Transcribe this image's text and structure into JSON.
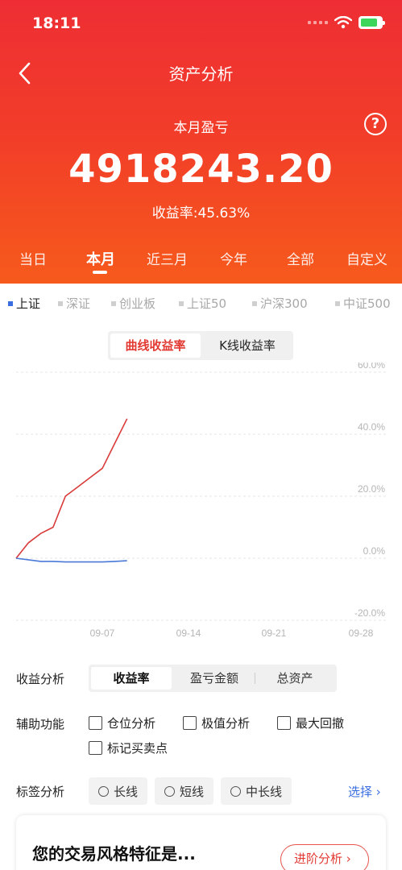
{
  "status_bar": {
    "time": "18:11"
  },
  "header": {
    "title": "资产分析",
    "period_label": "本月盈亏",
    "amount": "4918243.20",
    "yield_text": "收益率:45.63%",
    "help_glyph": "?"
  },
  "period_tabs": [
    "当日",
    "本月",
    "近三月",
    "今年",
    "全部",
    "自定义"
  ],
  "period_active": "本月",
  "index_tabs": [
    "上证",
    "深证",
    "创业板",
    "上证50",
    "沪深300",
    "中证500"
  ],
  "index_active": "上证",
  "chart_switch": {
    "options": [
      "曲线收益率",
      "K线收益率"
    ],
    "active": "曲线收益率"
  },
  "chart_data": {
    "type": "line",
    "y_ticks": [
      "60.0%",
      "40.0%",
      "20.0%",
      "0.0%",
      "-20.0%"
    ],
    "x_ticks": [
      "09-07",
      "09-14",
      "09-21",
      "09-28"
    ],
    "ylim": [
      -20,
      60
    ],
    "grid": true,
    "series": [
      {
        "color": "#d93a3a",
        "x": [
          0,
          1,
          2,
          3,
          4,
          5,
          6,
          7,
          8,
          9
        ],
        "values": [
          0,
          5,
          8,
          10,
          20,
          23,
          26,
          29,
          37,
          45
        ]
      },
      {
        "color": "#4a78d8",
        "x": [
          0,
          1,
          2,
          3,
          4,
          5,
          6,
          7,
          8,
          9
        ],
        "values": [
          0,
          -0.5,
          -1,
          -1,
          -1.2,
          -1.2,
          -1.2,
          -1.2,
          -1,
          -0.8
        ]
      }
    ]
  },
  "yield_analysis": {
    "label": "收益分析",
    "options": [
      "收益率",
      "盈亏金额",
      "总资产"
    ],
    "active": "收益率"
  },
  "aux": {
    "label": "辅助功能",
    "options": [
      "仓位分析",
      "极值分析",
      "最大回撤",
      "标记买卖点"
    ]
  },
  "tag_analysis": {
    "label": "标签分析",
    "options": [
      "长线",
      "短线",
      "中长线"
    ],
    "select_label": "选择"
  },
  "style_card": {
    "title": "您的交易风格特征是...",
    "button_label": "进阶分析"
  },
  "colors": {
    "header_top": "#ee2e34",
    "header_bottom": "#f65a1c",
    "accent_red": "#e23a32",
    "link_blue": "#3a6ee0"
  }
}
